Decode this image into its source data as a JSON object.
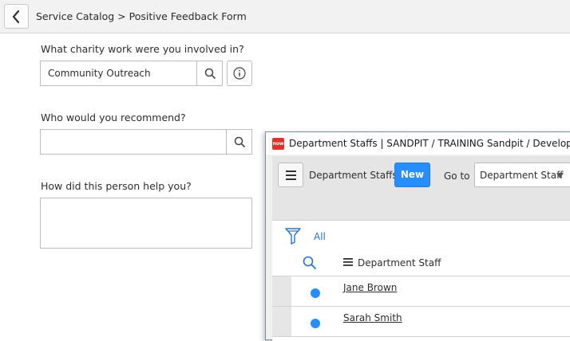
{
  "header": {
    "breadcrumb": "Service Catalog > Positive Feedback Form"
  },
  "form": {
    "q1_label": "What charity work were you involved in?",
    "q1_value": "Community Outreach",
    "q2_label": "Who would you recommend?",
    "q2_value": "",
    "q3_label": "How did this person help you?",
    "q3_value": ""
  },
  "popup": {
    "logo_text": "now",
    "window_title": "Department Staffs | SANDPIT / TRAINING Sandpit / Development",
    "list_title": "Department Staffs",
    "new_label": "New",
    "goto_label": "Go to",
    "goto_selected": "Department Staff",
    "filter_all": "All",
    "column_header": "Department Staff",
    "rows": [
      {
        "name": "Jane Brown"
      },
      {
        "name": "Sarah Smith"
      }
    ]
  },
  "colors": {
    "accent": "#278efc",
    "logo_red": "#e0322d",
    "link": "#2774c7"
  }
}
